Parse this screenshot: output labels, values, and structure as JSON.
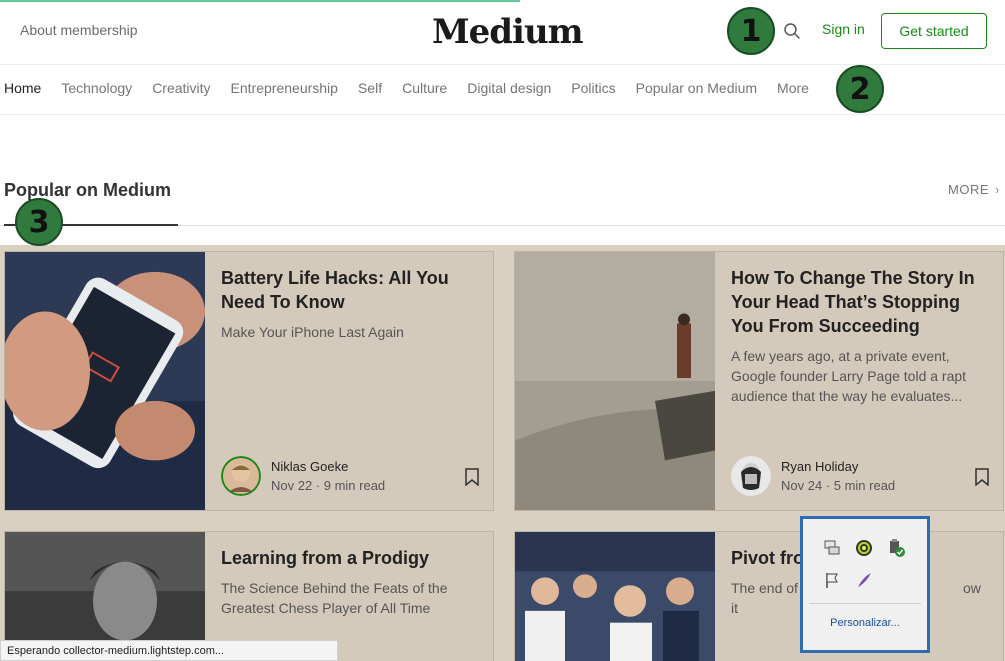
{
  "header": {
    "about": "About membership",
    "logo": "Medium",
    "sign_in": "Sign in",
    "get_started": "Get started"
  },
  "nav": {
    "items": [
      "Home",
      "Technology",
      "Creativity",
      "Entrepreneurship",
      "Self",
      "Culture",
      "Digital design",
      "Politics",
      "Popular on Medium",
      "More"
    ],
    "active": "Home"
  },
  "section": {
    "title": "Popular on Medium",
    "more": "MORE"
  },
  "cards": [
    {
      "title": "Battery Life Hacks: All You Need To Know",
      "subtitle": "Make Your iPhone Last Again",
      "author": "Niklas Goeke",
      "meta": "Nov 22 · 9 min read"
    },
    {
      "title": "How To Change The Story In Your Head That’s Stopping You From Succeeding",
      "subtitle": "A few years ago, at a private event, Google founder Larry Page told a rapt audience that the way he evaluates...",
      "author": "Ryan Holiday",
      "meta": "Nov 24 · 5 min read"
    },
    {
      "title": "Learning from a Prodigy",
      "subtitle": "The Science Behind the Feats of the Greatest Chess Player of All Time"
    },
    {
      "title": "Pivot fro",
      "subtitle": "The end of",
      "subtitle_tail": "ow it"
    }
  ],
  "badges": [
    "1",
    "2",
    "3"
  ],
  "status_bar": "Esperando collector-medium.lightstep.com...",
  "tray": {
    "customize": "Personalizar..."
  },
  "colors": {
    "accent": "#1a8917",
    "card_bg": "#d4cabb",
    "badge": "#2f7a3c",
    "tray_border": "#2e6db4"
  }
}
